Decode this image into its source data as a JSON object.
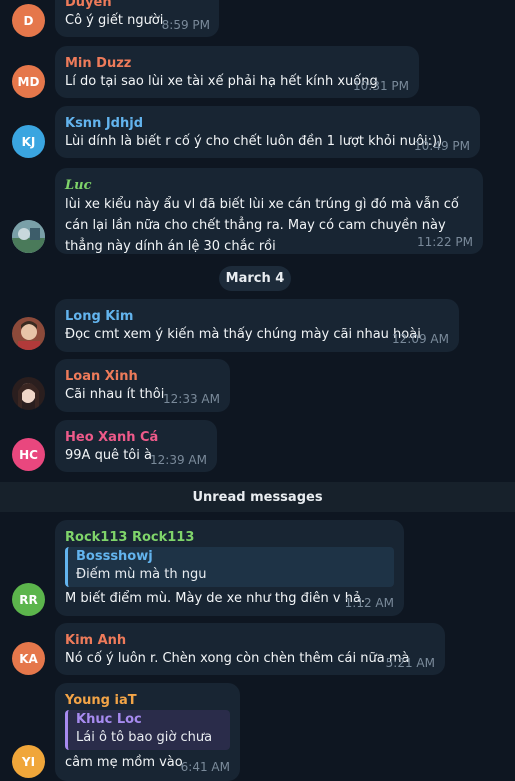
{
  "messages": [
    {
      "id": "duyen",
      "sender": "Duyen",
      "initials": "D",
      "text": "Cô ý giết người",
      "time": "8:59 PM"
    },
    {
      "id": "minduzz",
      "sender": "Min Duzz",
      "initials": "MD",
      "text": "Lí do tại sao lùi xe tài xế phải hạ hết kính xuống",
      "time": "10:31 PM"
    },
    {
      "id": "ksnn",
      "sender": "Ksnn Jdhjd",
      "initials": "KJ",
      "text": "Lùi dính là biết r cố ý cho chết luôn đền 1 lượt khỏi nuôi:))",
      "time": "10:49 PM"
    },
    {
      "id": "luc",
      "sender": "Luc",
      "initials": "",
      "text": "lùi xe kiểu này ẩu vl đã biết lùi xe cán trúng gì đó mà vẫn cố cán lại lần nữa cho chết thẳng ra. May có cam chuyền này thẳng này dính án lệ 30 chắc rồi",
      "time": "11:22 PM"
    },
    {
      "id": "longkim",
      "sender": "Long Kim",
      "initials": "",
      "text": "Đọc cmt xem ý kiến mà thấy chúng mày cãi nhau hoài",
      "time": "12:09 AM"
    },
    {
      "id": "loanxinh",
      "sender": "Loan Xinh",
      "initials": "",
      "text": "Cãi nhau ít thôi",
      "time": "12:33 AM"
    },
    {
      "id": "heoxanh",
      "sender": "Heo Xanh Cá",
      "initials": "HC",
      "text": "99A quê tôi à",
      "time": "12:39 AM"
    },
    {
      "id": "rock",
      "sender": "Rock113 Rock113",
      "initials": "RR",
      "reply_name": "Bossshowj",
      "reply_text": "Điếm mù mà th ngu",
      "text": "M biết điểm mù. Mày de xe như thg điên v hả.",
      "time": "1:12 AM"
    },
    {
      "id": "kimanh",
      "sender": "Kim Anh",
      "initials": "KA",
      "text": "Nó cố ý luôn r. Chèn xong còn chèn thêm cái nữa mà",
      "time": "5:21 AM"
    },
    {
      "id": "youngiat",
      "sender": "Young iaT",
      "initials": "YI",
      "reply_name": "Khuc Loc",
      "reply_text": "Lái ô tô bao giờ chưa",
      "text": "câm mẹ mồm vào",
      "time": "6:41 AM"
    }
  ],
  "date_separator": "March 4",
  "unread_label": "Unread messages",
  "colors": {
    "background": "#0e1621",
    "bubble": "#182533",
    "time": "#7a8a9a",
    "avatar_d": "#e5774b",
    "avatar_md": "#e5774b",
    "avatar_kj": "#3aa5e0",
    "avatar_hc": "#e9477e",
    "avatar_rr": "#5cb54c",
    "avatar_ka": "#e5774b",
    "avatar_yi": "#f0a63a",
    "name_duyen": "#ee7b5a",
    "name_minduzz": "#ee7b5a",
    "name_ksnn": "#63b4ee",
    "name_luc": "#7fd46a",
    "name_longkim": "#63b4ee",
    "name_loanxinh": "#ee7b5a",
    "name_heoxanh": "#ee5a8a",
    "name_rock": "#7fd46a",
    "name_kimanh": "#ee7b5a",
    "name_youngiat": "#f2a447",
    "reply_bossshowj": "#63b4ee",
    "reply_khucloc": "#a78bf0"
  }
}
